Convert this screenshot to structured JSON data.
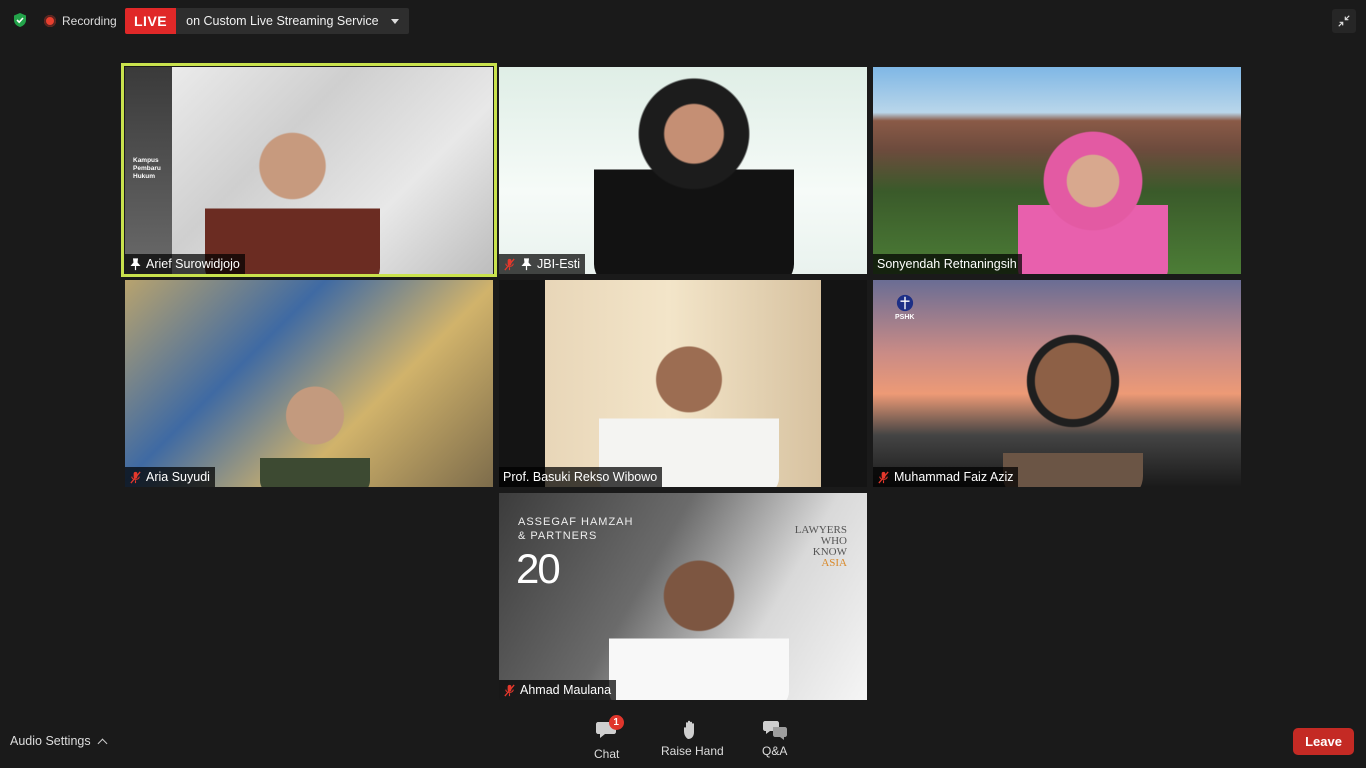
{
  "topbar": {
    "recording_label": "Recording",
    "live_badge": "LIVE",
    "live_service": "on Custom Live Streaming Service"
  },
  "tiles": [
    {
      "name": "Arief Surowidjojo",
      "status_icon": "pin-icon",
      "background_text": "Kampus Pembaru Hukum"
    },
    {
      "name": "JBI-Esti",
      "status_icon": "pin-icon"
    },
    {
      "name": "Sonyendah Retnaningsih"
    },
    {
      "name": "Aria Suyudi",
      "status_icon": "muted-mic-icon"
    },
    {
      "name": "Prof. Basuki Rekso Wibowo"
    },
    {
      "name": "Muhammad Faiz Aziz",
      "status_icon": "muted-mic-icon",
      "logo_text": "PSHK"
    },
    {
      "name": "Ahmad Maulana",
      "status_icon": "muted-mic-icon",
      "brand_line1": "ASSEGAF HAMZAH",
      "brand_line2": "& PARTNERS",
      "brand_number": "20",
      "side_line1": "LAWYERS",
      "side_line2": "WHO",
      "side_line3": "KNOW",
      "side_line4": "ASIA"
    }
  ],
  "bottombar": {
    "audio_settings": "Audio Settings",
    "chat_label": "Chat",
    "chat_badge": "1",
    "raise_hand_label": "Raise Hand",
    "qa_label": "Q&A",
    "leave_label": "Leave"
  },
  "colors": {
    "live_red": "#e02828",
    "active_speaker": "#c9e24d",
    "leave_red": "#c42a24"
  }
}
